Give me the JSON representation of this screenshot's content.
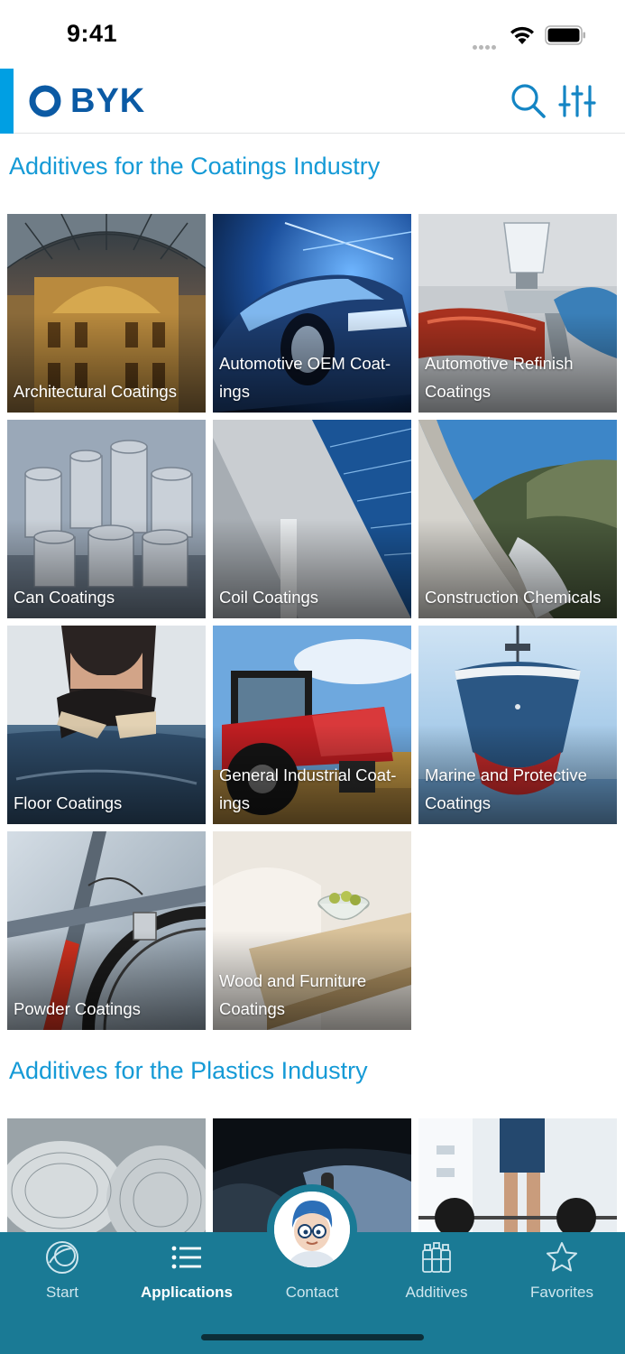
{
  "status_bar": {
    "time": "9:41"
  },
  "header": {
    "logo_text": "BYK",
    "accent_color": "#009fe3",
    "brand_color": "#0b5aa4",
    "icons": [
      "search-icon",
      "filter-sliders-icon"
    ]
  },
  "sections": [
    {
      "title": "Additives for the Coatings Industry",
      "tiles": [
        {
          "label": "Architectural Coatings"
        },
        {
          "label": "Automotive OEM Coat-ings"
        },
        {
          "label": "Automotive Refinish Coatings"
        },
        {
          "label": "Can Coatings"
        },
        {
          "label": "Coil Coatings"
        },
        {
          "label": "Construction Chemicals"
        },
        {
          "label": "Floor Coatings"
        },
        {
          "label": "General Industrial Coat-ings"
        },
        {
          "label": "Marine and Protective Coatings"
        },
        {
          "label": "Powder Coatings"
        },
        {
          "label": "Wood and Furniture Coatings"
        }
      ]
    },
    {
      "title": "Additives for the Plastics Industry",
      "tiles": []
    }
  ],
  "tab_bar": {
    "color": "#1a7a95",
    "tabs": [
      {
        "label": "Start",
        "icon": "start-icon",
        "active": false
      },
      {
        "label": "Applications",
        "icon": "list-icon",
        "active": true
      },
      {
        "label": "Contact",
        "icon": "contact-avatar",
        "active": false
      },
      {
        "label": "Additives",
        "icon": "bottles-icon",
        "active": false
      },
      {
        "label": "Favorites",
        "icon": "star-icon",
        "active": false
      }
    ]
  }
}
